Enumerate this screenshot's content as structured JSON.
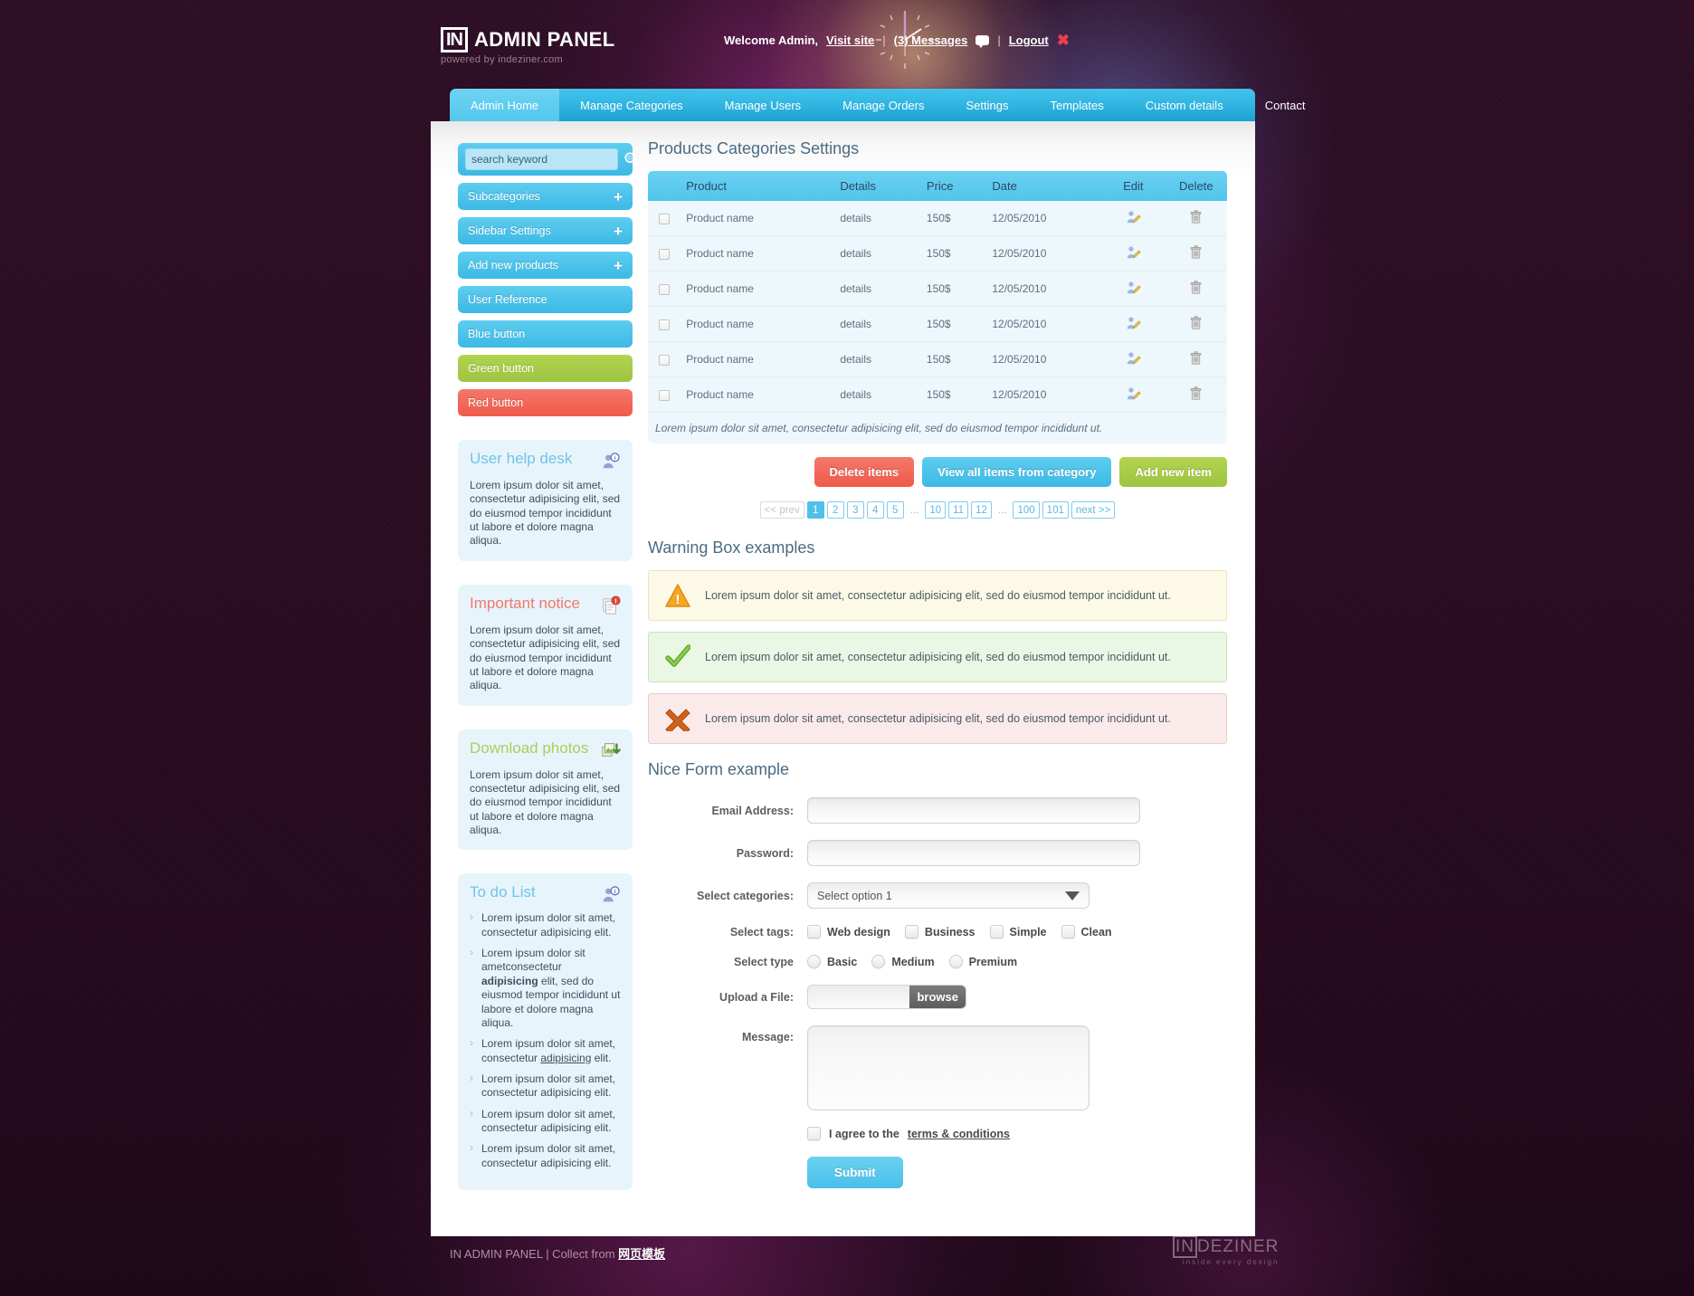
{
  "header": {
    "logo_mark": "IN",
    "logo_text": "ADMIN PANEL",
    "logo_sub": "powered by indeziner.com",
    "welcome": "Welcome Admin,",
    "visit_site": "Visit site",
    "sep1": "|",
    "messages": "(3) Messages",
    "sep2": "|",
    "logout": "Logout",
    "clock_icon": "analog-clock-icon"
  },
  "nav": {
    "tabs": [
      {
        "label": "Admin Home",
        "active": true
      },
      {
        "label": "Manage Categories",
        "active": false
      },
      {
        "label": "Manage Users",
        "active": false
      },
      {
        "label": "Manage Orders",
        "active": false
      },
      {
        "label": "Settings",
        "active": false
      },
      {
        "label": "Templates",
        "active": false
      },
      {
        "label": "Custom details",
        "active": false
      },
      {
        "label": "Contact",
        "active": false
      }
    ]
  },
  "sidebar": {
    "search_placeholder": "search keyword",
    "buttons": [
      {
        "label": "Subcategories",
        "plus": "+",
        "style": "blue"
      },
      {
        "label": "Sidebar Settings",
        "plus": "+",
        "style": "blue"
      },
      {
        "label": "Add new products",
        "plus": "+",
        "style": "blue"
      },
      {
        "label": "User Reference",
        "plus": "",
        "style": "blue"
      },
      {
        "label": "Blue button",
        "plus": "",
        "style": "blue"
      },
      {
        "label": "Green button",
        "plus": "",
        "style": "green"
      },
      {
        "label": "Red button",
        "plus": "",
        "style": "red"
      }
    ],
    "widgets": [
      {
        "title": "User help desk",
        "icon": "user-info-icon",
        "body": "Lorem ipsum dolor sit amet, consectetur adipisicing elit, sed do eiusmod tempor incididunt ut labore et dolore magna aliqua."
      },
      {
        "title": "Important notice",
        "icon": "document-alert-icon",
        "body": "Lorem ipsum dolor sit amet, consectetur adipisicing elit, sed do eiusmod tempor incididunt ut labore et dolore magna aliqua."
      },
      {
        "title": "Download photos",
        "icon": "download-photo-icon",
        "body": "Lorem ipsum dolor sit amet, consectetur adipisicing elit, sed do eiusmod tempor incididunt ut labore et dolore magna aliqua."
      }
    ],
    "todo": {
      "title": "To do List",
      "icon": "user-info-icon",
      "items": [
        {
          "text": "Lorem ipsum dolor sit amet, consectetur adipisicing elit."
        },
        {
          "text": "Lorem ipsum dolor sit ametconsectetur adipisicing elit, sed do eiusmod tempor incididunt ut labore et dolore magna aliqua.",
          "bold_word": "adipisicing"
        },
        {
          "text": "Lorem ipsum dolor sit amet, consectetur adipisicing elit.",
          "link_word": "adipisicing"
        },
        {
          "text": "Lorem ipsum dolor sit amet, consectetur adipisicing elit."
        },
        {
          "text": "Lorem ipsum dolor sit amet, consectetur adipisicing elit."
        },
        {
          "text": "Lorem ipsum dolor sit amet, consectetur adipisicing elit."
        }
      ]
    }
  },
  "content": {
    "table_title": "Products Categories Settings",
    "columns": [
      "",
      "Product",
      "Details",
      "Price",
      "Date",
      "Edit",
      "Delete"
    ],
    "rows": [
      {
        "product": "Product name",
        "details": "details",
        "price": "150$",
        "date": "12/05/2010"
      },
      {
        "product": "Product name",
        "details": "details",
        "price": "150$",
        "date": "12/05/2010"
      },
      {
        "product": "Product name",
        "details": "details",
        "price": "150$",
        "date": "12/05/2010"
      },
      {
        "product": "Product name",
        "details": "details",
        "price": "150$",
        "date": "12/05/2010"
      },
      {
        "product": "Product name",
        "details": "details",
        "price": "150$",
        "date": "12/05/2010"
      },
      {
        "product": "Product name",
        "details": "details",
        "price": "150$",
        "date": "12/05/2010"
      }
    ],
    "table_note": "Lorem ipsum dolor sit amet, consectetur adipisicing elit, sed do eiusmod tempor incididunt ut.",
    "buttons": {
      "delete": "Delete items",
      "view_all": "View all items from category",
      "add_new": "Add new item"
    },
    "pagination": [
      {
        "label": "<< prev",
        "state": "disabled"
      },
      {
        "label": "1",
        "state": "active"
      },
      {
        "label": "2",
        "state": ""
      },
      {
        "label": "3",
        "state": ""
      },
      {
        "label": "4",
        "state": ""
      },
      {
        "label": "5",
        "state": ""
      },
      {
        "label": "...",
        "state": "dots"
      },
      {
        "label": "10",
        "state": ""
      },
      {
        "label": "11",
        "state": ""
      },
      {
        "label": "12",
        "state": ""
      },
      {
        "label": "...",
        "state": "dots"
      },
      {
        "label": "100",
        "state": ""
      },
      {
        "label": "101",
        "state": ""
      },
      {
        "label": "next >>",
        "state": ""
      }
    ],
    "warning_title": "Warning Box examples",
    "alerts": [
      {
        "type": "warn",
        "icon": "warning-triangle-icon",
        "text": "Lorem ipsum dolor sit amet, consectetur adipisicing elit, sed do eiusmod tempor incididunt ut."
      },
      {
        "type": "ok",
        "icon": "checkmark-icon",
        "text": "Lorem ipsum dolor sit amet, consectetur adipisicing elit, sed do eiusmod tempor incididunt ut."
      },
      {
        "type": "err",
        "icon": "x-cross-icon",
        "text": "Lorem ipsum dolor sit amet, consectetur adipisicing elit, sed do eiusmod tempor incididunt ut."
      }
    ],
    "form_title": "Nice Form example",
    "form": {
      "email_label": "Email Address:",
      "email_value": "",
      "password_label": "Password:",
      "password_value": "",
      "categories_label": "Select categories:",
      "categories_value": "Select option 1",
      "tags_label": "Select tags:",
      "tags": [
        "Web design",
        "Business",
        "Simple",
        "Clean"
      ],
      "type_label": "Select type",
      "types": [
        "Basic",
        "Medium",
        "Premium"
      ],
      "upload_label": "Upload a File:",
      "upload_value": "",
      "browse_label": "browse",
      "message_label": "Message:",
      "message_value": "",
      "agree_prefix": "I agree to the",
      "agree_link": "terms & conditions",
      "submit_label": "Submit"
    }
  },
  "footer": {
    "text_prefix": "IN ADMIN PANEL | Collect from ",
    "text_cn": "网页模板",
    "brand_in": "IN",
    "brand_rest": "DEZINER",
    "brand_sub": "inside every design"
  }
}
